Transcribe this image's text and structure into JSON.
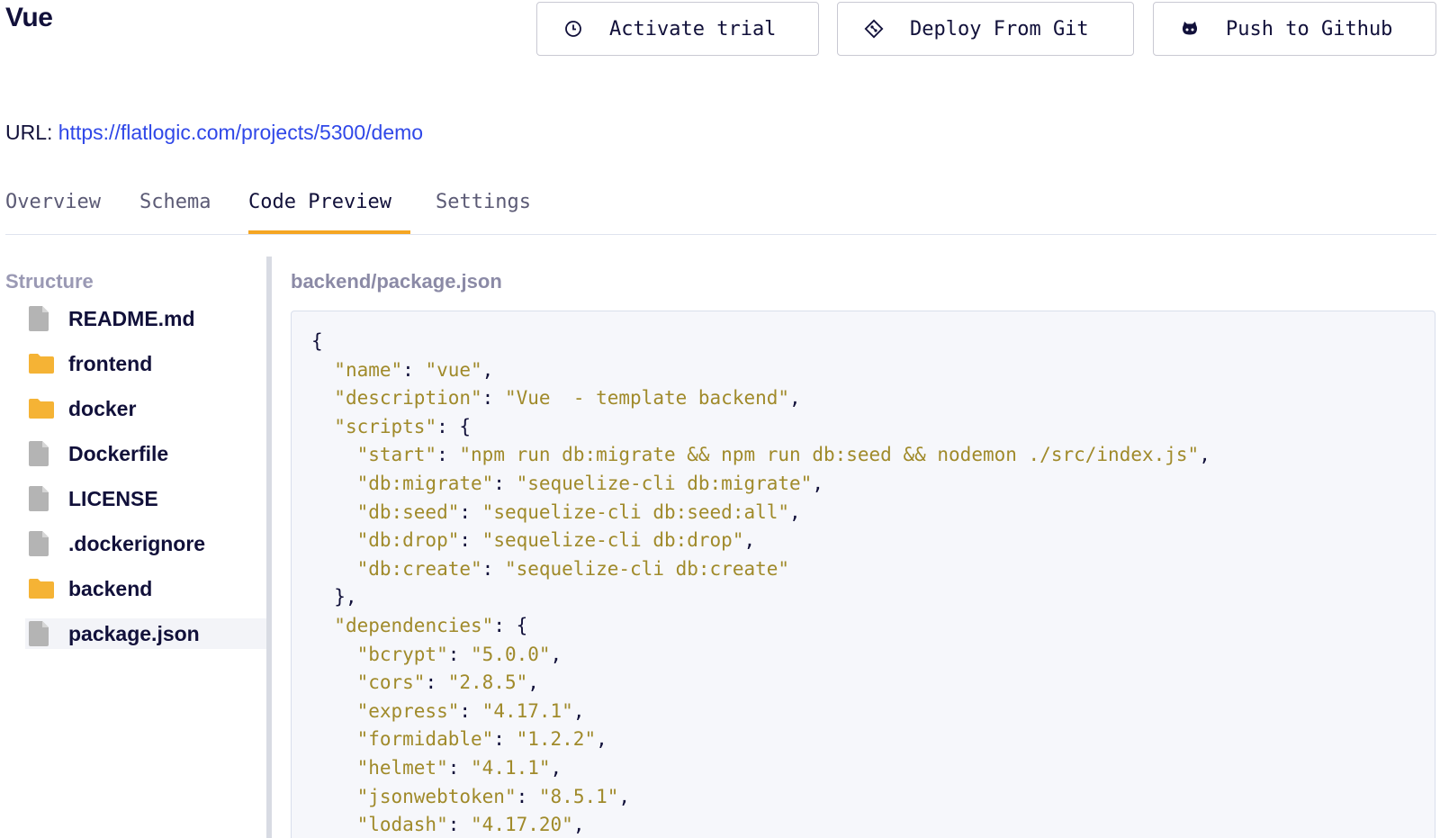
{
  "project": {
    "title": "Vue"
  },
  "actions": {
    "trial_label": "Activate trial",
    "deploy_label": "Deploy From Git",
    "github_label": "Push to Github"
  },
  "url": {
    "label": "URL:",
    "link": "https://flatlogic.com/projects/5300/demo"
  },
  "tabs": [
    {
      "label": "Overview"
    },
    {
      "label": "Schema"
    },
    {
      "label": "Code Preview",
      "active": true
    },
    {
      "label": "Settings"
    }
  ],
  "sidebar": {
    "title": "Structure",
    "items": [
      {
        "label": "README.md",
        "icon": "file-icon"
      },
      {
        "label": "frontend",
        "icon": "folder-icon"
      },
      {
        "label": "docker",
        "icon": "folder-icon"
      },
      {
        "label": "Dockerfile",
        "icon": "file-icon"
      },
      {
        "label": "LICENSE",
        "icon": "file-icon"
      },
      {
        "label": ".dockerignore",
        "icon": "file-icon"
      },
      {
        "label": "backend",
        "icon": "folder-icon"
      },
      {
        "label": "package.json",
        "icon": "file-icon",
        "selected": true
      }
    ]
  },
  "code": {
    "path": "backend/package.json",
    "lines": [
      "{",
      "  \"name\": \"vue\",",
      "  \"description\": \"Vue  - template backend\",",
      "  \"scripts\": {",
      "    \"start\": \"npm run db:migrate && npm run db:seed && nodemon ./src/index.js\",",
      "    \"db:migrate\": \"sequelize-cli db:migrate\",",
      "    \"db:seed\": \"sequelize-cli db:seed:all\",",
      "    \"db:drop\": \"sequelize-cli db:drop\",",
      "    \"db:create\": \"sequelize-cli db:create\"",
      "  },",
      "  \"dependencies\": {",
      "    \"bcrypt\": \"5.0.0\",",
      "    \"cors\": \"2.8.5\",",
      "    \"express\": \"4.17.1\",",
      "    \"formidable\": \"1.2.2\",",
      "    \"helmet\": \"4.1.1\",",
      "    \"jsonwebtoken\": \"8.5.1\",",
      "    \"lodash\": \"4.17.20\","
    ]
  },
  "colors": {
    "accent_tab": "#f5a623",
    "link": "#2f47e8",
    "folder": "#f5b335",
    "file": "#b4b4b4",
    "code_string": "#a08a2a"
  }
}
